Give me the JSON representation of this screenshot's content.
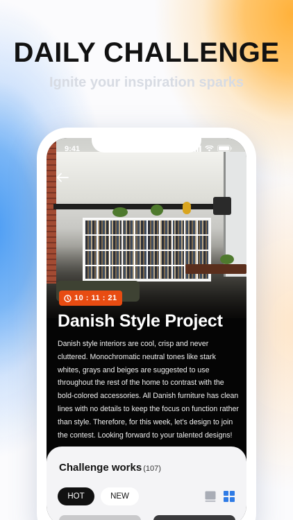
{
  "hero": {
    "title": "DAILY CHALLENGE",
    "subtitle": "Ignite your inspiration sparks"
  },
  "status_bar": {
    "time": "9:41"
  },
  "icons": {
    "back": "back-arrow-icon",
    "timer": "clock-icon",
    "list_view": "list-view-icon",
    "grid_view": "grid-view-icon"
  },
  "project": {
    "timer": "10 : 11 : 21",
    "title": "Danish Style Project",
    "description": "Danish style interiors are cool, crisp and never cluttered. Monochromatic neutral tones like stark whites, grays and beiges are suggested to use throughout the rest of the home to contrast with the bold-colored accessories. All Danish furniture has clean lines with no details to keep the focus on function rather than style. Therefore, for this week, let’s design to join the contest. Looking forward to your talented designs!"
  },
  "works": {
    "title": "Challenge works",
    "count": "(107)",
    "tabs": [
      "HOT",
      "NEW"
    ]
  },
  "colors": {
    "accent": "#e84c12",
    "grid_active": "#2f7be5"
  }
}
